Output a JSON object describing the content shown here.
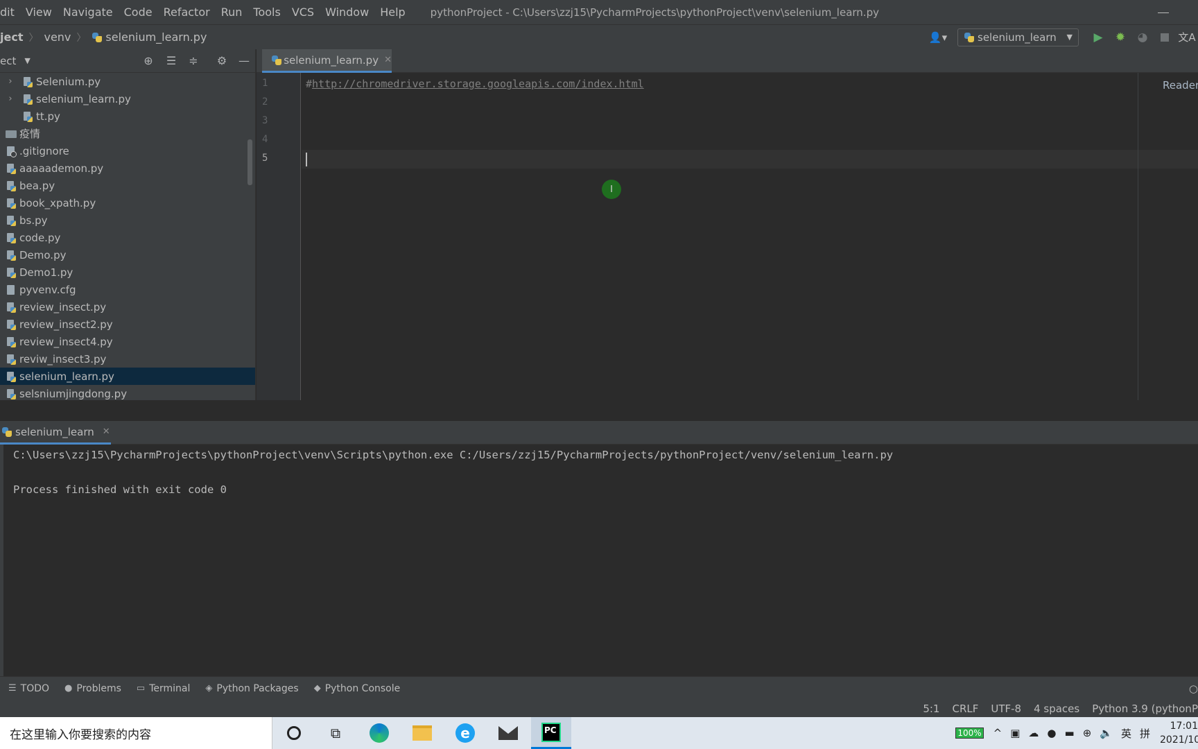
{
  "menu": {
    "items": [
      "dit",
      "View",
      "Navigate",
      "Code",
      "Refactor",
      "Run",
      "Tools",
      "VCS",
      "Window",
      "Help"
    ],
    "window_title": "pythonProject - C:\\Users\\zzj15\\PycharmProjects\\pythonProject\\venv\\selenium_learn.py"
  },
  "breadcrumb": {
    "project": "ject",
    "folder": "venv",
    "file": "selenium_learn.py"
  },
  "toolbar": {
    "run_config": "selenium_learn",
    "icons": [
      "user-icon",
      "run-icon",
      "debug-icon",
      "coverage-icon",
      "stop-icon",
      "translate-icon"
    ]
  },
  "project_panel": {
    "title": "ect",
    "files": [
      {
        "name": "Selenium.py",
        "type": "py",
        "indent": 1,
        "expandable": true,
        "selected": false
      },
      {
        "name": "selenium_learn.py",
        "type": "py",
        "indent": 1,
        "expandable": true,
        "selected": false
      },
      {
        "name": "tt.py",
        "type": "py",
        "indent": 1,
        "expandable": false,
        "selected": false
      },
      {
        "name": "疫情",
        "type": "folder",
        "indent": 0,
        "expandable": false,
        "selected": false
      },
      {
        "name": ".gitignore",
        "type": "git",
        "indent": 0,
        "expandable": false,
        "selected": false
      },
      {
        "name": "aaaaademon.py",
        "type": "py",
        "indent": 0,
        "expandable": false,
        "selected": false
      },
      {
        "name": "bea.py",
        "type": "py",
        "indent": 0,
        "expandable": false,
        "selected": false
      },
      {
        "name": "book_xpath.py",
        "type": "py",
        "indent": 0,
        "expandable": false,
        "selected": false
      },
      {
        "name": "bs.py",
        "type": "py",
        "indent": 0,
        "expandable": false,
        "selected": false
      },
      {
        "name": "code.py",
        "type": "py",
        "indent": 0,
        "expandable": false,
        "selected": false
      },
      {
        "name": "Demo.py",
        "type": "py",
        "indent": 0,
        "expandable": false,
        "selected": false
      },
      {
        "name": "Demo1.py",
        "type": "py",
        "indent": 0,
        "expandable": false,
        "selected": false
      },
      {
        "name": "pyvenv.cfg",
        "type": "txt",
        "indent": 0,
        "expandable": false,
        "selected": false
      },
      {
        "name": "review_insect.py",
        "type": "py",
        "indent": 0,
        "expandable": false,
        "selected": false
      },
      {
        "name": "review_insect2.py",
        "type": "py",
        "indent": 0,
        "expandable": false,
        "selected": false
      },
      {
        "name": "review_insect4.py",
        "type": "py",
        "indent": 0,
        "expandable": false,
        "selected": false
      },
      {
        "name": "reviw_insect3.py",
        "type": "py",
        "indent": 0,
        "expandable": false,
        "selected": false
      },
      {
        "name": "selenium_learn.py",
        "type": "py",
        "indent": 0,
        "expandable": false,
        "selected": true
      },
      {
        "name": "selsniumjingdong.py",
        "type": "py",
        "indent": 0,
        "expandable": false,
        "selected": false
      },
      {
        "name": "test.py",
        "type": "py",
        "indent": 0,
        "expandable": false,
        "selected": false
      }
    ]
  },
  "editor": {
    "tab_label": "selenium_learn.py",
    "line_numbers": [
      "1",
      "2",
      "3",
      "4",
      "5"
    ],
    "code_hash": "#",
    "code_url": "http://chromedriver.storage.googleapis.com/index.html",
    "reader_mode": "Reader"
  },
  "run_panel": {
    "tab_label": "selenium_learn",
    "output": [
      "C:\\Users\\zzj15\\PycharmProjects\\pythonProject\\venv\\Scripts\\python.exe C:/Users/zzj15/PycharmProjects/pythonProject/venv/selenium_learn.py",
      "",
      "Process finished with exit code 0"
    ]
  },
  "tool_windows": {
    "todo": "TODO",
    "problems": "Problems",
    "terminal": "Terminal",
    "python_packages": "Python Packages",
    "python_console": "Python Console"
  },
  "status_bar": {
    "position": "5:1",
    "line_sep": "CRLF",
    "encoding": "UTF-8",
    "indent": "4 spaces",
    "interpreter": "Python 3.9 (pythonP"
  },
  "taskbar": {
    "search_placeholder": "在这里输入你要搜索的内容",
    "battery": "100%",
    "ime_lang": "英",
    "ime_mode": "拼",
    "time": "17:01",
    "date": "2021/10"
  },
  "colors": {
    "accent": "#4a88c7",
    "selection": "#0d293e",
    "editor_bg": "#2b2b2b",
    "panel_bg": "#3c3f41"
  }
}
